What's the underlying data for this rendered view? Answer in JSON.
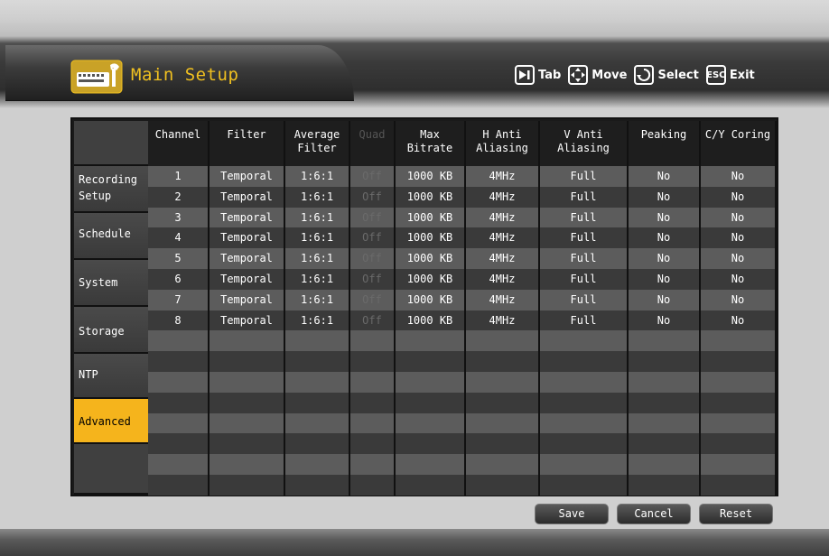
{
  "header": {
    "title": "Main Setup",
    "hints": [
      {
        "key": "tab-key",
        "label": "Tab"
      },
      {
        "key": "move-key",
        "label": "Move"
      },
      {
        "key": "select-key",
        "label": "Select"
      },
      {
        "key": "esc-key",
        "key_text": "ESC",
        "label": "Exit"
      }
    ]
  },
  "sidebar": {
    "items": [
      {
        "label": "Recording Setup"
      },
      {
        "label": "Schedule"
      },
      {
        "label": "System"
      },
      {
        "label": "Storage"
      },
      {
        "label": "NTP"
      },
      {
        "label": "Advanced",
        "active": true
      }
    ]
  },
  "table": {
    "columns": [
      "Channel",
      "Filter",
      "Average Filter",
      "Quad",
      "Max Bitrate",
      "H Anti Aliasing",
      "V Anti Aliasing",
      "Peaking",
      "C/Y Coring"
    ],
    "rows": [
      [
        "1",
        "Temporal",
        "1:6:1",
        "Off",
        "1000 KB",
        "4MHz",
        "Full",
        "No",
        "No"
      ],
      [
        "2",
        "Temporal",
        "1:6:1",
        "Off",
        "1000 KB",
        "4MHz",
        "Full",
        "No",
        "No"
      ],
      [
        "3",
        "Temporal",
        "1:6:1",
        "Off",
        "1000 KB",
        "4MHz",
        "Full",
        "No",
        "No"
      ],
      [
        "4",
        "Temporal",
        "1:6:1",
        "Off",
        "1000 KB",
        "4MHz",
        "Full",
        "No",
        "No"
      ],
      [
        "5",
        "Temporal",
        "1:6:1",
        "Off",
        "1000 KB",
        "4MHz",
        "Full",
        "No",
        "No"
      ],
      [
        "6",
        "Temporal",
        "1:6:1",
        "Off",
        "1000 KB",
        "4MHz",
        "Full",
        "No",
        "No"
      ],
      [
        "7",
        "Temporal",
        "1:6:1",
        "Off",
        "1000 KB",
        "4MHz",
        "Full",
        "No",
        "No"
      ],
      [
        "8",
        "Temporal",
        "1:6:1",
        "Off",
        "1000 KB",
        "4MHz",
        "Full",
        "No",
        "No"
      ]
    ],
    "empty_rows": 8
  },
  "buttons": {
    "save": "Save",
    "cancel": "Cancel",
    "reset": "Reset"
  },
  "colors": {
    "title": "#f0c020",
    "active_tab": "#f5b41c",
    "row_light": "#5c5c5c",
    "row_dark": "#3a3a3a"
  }
}
